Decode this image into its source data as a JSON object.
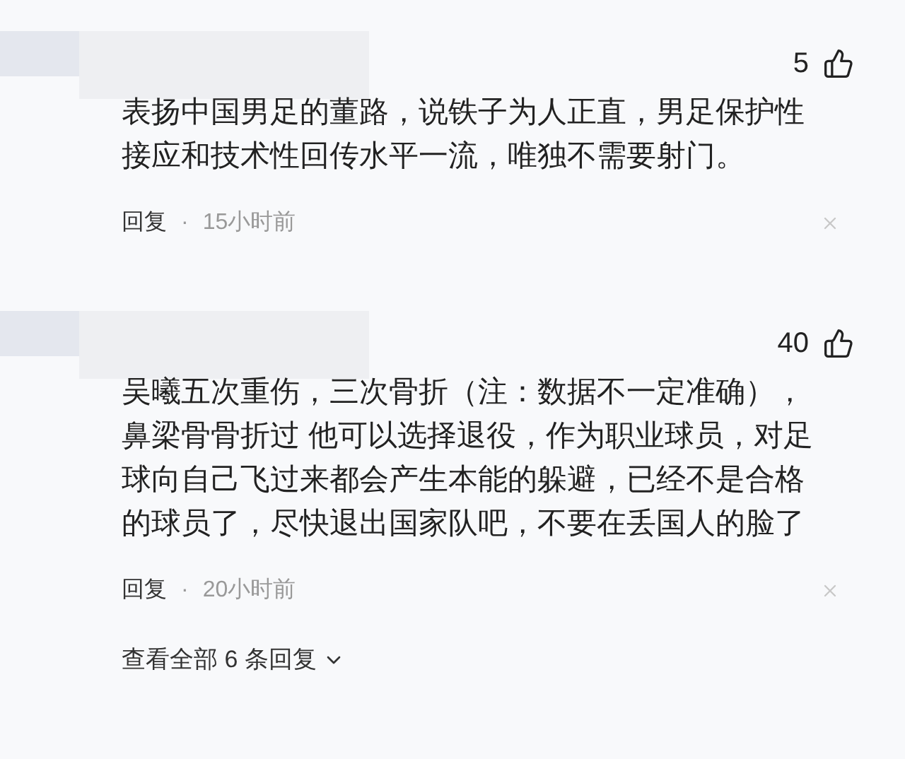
{
  "comments": [
    {
      "likes": "5",
      "lines": [
        "表扬中国男足的董路，说铁子为人正直，男足保护性",
        "接应和技术性回传水平一流，唯独不需要射门。"
      ],
      "reply": "回复",
      "dot": "·",
      "time": "15小时前"
    },
    {
      "likes": "40",
      "lines": [
        "吴曦五次重伤，三次骨折（注：数据不一定准确），",
        "鼻梁骨骨折过 他可以选择退役，作为职业球员，对足",
        "球向自己飞过来都会产生本能的躲避，已经不是合格",
        "的球员了，尽快退出国家队吧，不要在丢国人的脸了"
      ],
      "reply": "回复",
      "dot": "·",
      "time": "20小时前",
      "view_all": "查看全部 6 条回复"
    }
  ]
}
